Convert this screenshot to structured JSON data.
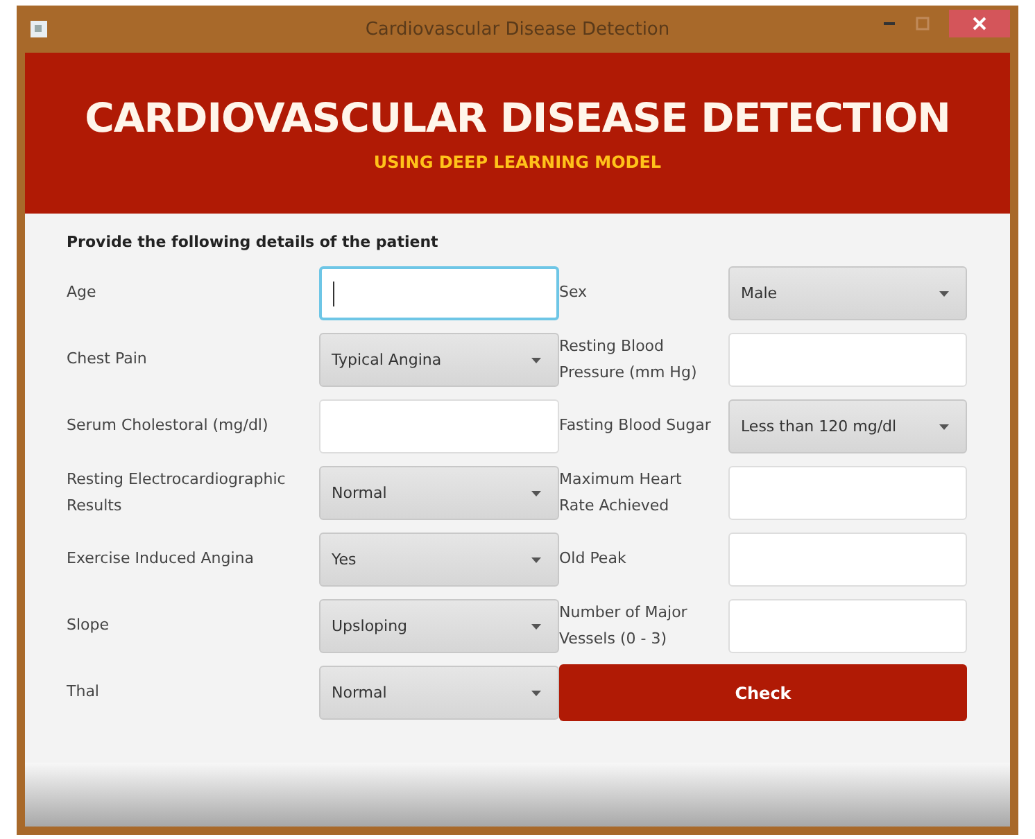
{
  "window": {
    "title": "Cardiovascular Disease Detection"
  },
  "header": {
    "title": "CARDIOVASCULAR DISEASE DETECTION",
    "subtitle": "USING DEEP LEARNING MODEL"
  },
  "instruction": "Provide the following details of the patient",
  "fields": [
    {
      "label": "Age",
      "kind": "text",
      "focused": true
    },
    {
      "label": "Sex",
      "kind": "select",
      "value": "Male"
    },
    {
      "label": "Chest Pain",
      "kind": "select",
      "value": "Typical Angina"
    },
    {
      "label": "Resting Blood Pressure (mm Hg)",
      "kind": "text",
      "focused": false
    },
    {
      "label": "Serum Cholestoral (mg/dl)",
      "kind": "text",
      "focused": false
    },
    {
      "label": "Fasting Blood Sugar",
      "kind": "select",
      "value": "Less than 120 mg/dl"
    },
    {
      "label": "Resting Electrocardiographic Results",
      "kind": "select",
      "value": "Normal"
    },
    {
      "label": "Maximum Heart Rate Achieved",
      "kind": "text",
      "focused": false
    },
    {
      "label": "Exercise Induced Angina",
      "kind": "select",
      "value": "Yes"
    },
    {
      "label": "Old Peak",
      "kind": "text",
      "focused": false
    },
    {
      "label": "Slope",
      "kind": "select",
      "value": "Upsloping"
    },
    {
      "label": "Number of Major Vessels (0 - 3)",
      "kind": "text",
      "focused": false
    },
    {
      "label": "Thal",
      "kind": "select",
      "value": "Normal"
    },
    {
      "label": "Check",
      "kind": "button"
    }
  ]
}
